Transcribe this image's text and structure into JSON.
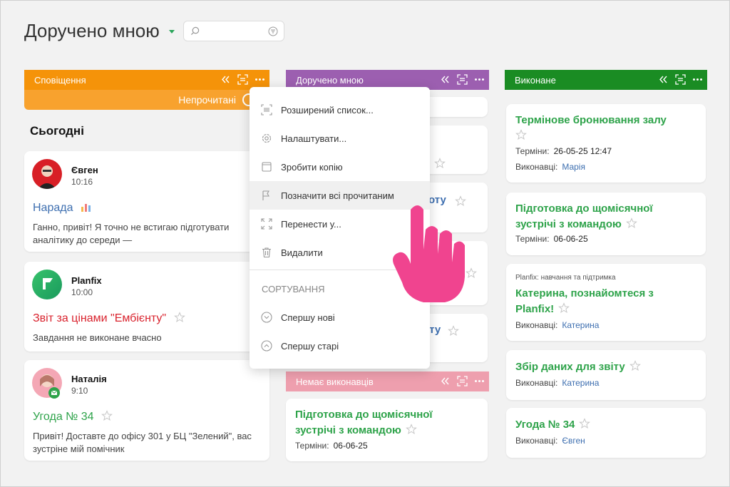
{
  "page": {
    "title": "Доручено мною"
  },
  "search": {
    "placeholder": ""
  },
  "columns": {
    "notifications": {
      "label": "Сповіщення",
      "unread_label": "Непрочитані"
    },
    "assigned": {
      "label": "Доручено мною"
    },
    "done": {
      "label": "Виконане"
    },
    "no_assignee": {
      "label": "Немає виконавців"
    }
  },
  "notifications": {
    "section": "Сьогодні",
    "items": [
      {
        "author": "Євген",
        "time": "10:16",
        "title": "Нарада",
        "title_color": "#3e6fb0",
        "body": "Ганно, привіт! Я точно не встигаю підготувати аналітику до середи —"
      },
      {
        "author": "Planfix",
        "time": "10:00",
        "title": "Звіт за цінами \"Ембієнту\"",
        "title_color": "#d9232e",
        "body": "Завдання не виконане вчасно"
      },
      {
        "author": "Наталія",
        "time": "9:10",
        "title": "Угода № 34",
        "title_color": "#2ea34a",
        "body": "Привіт! Доставте до офісу 301 у БЦ \"Зелений\", вас зустріне мій помічник"
      }
    ]
  },
  "assigned_visible": {
    "partial_1": "оту",
    "partial_2": "іту"
  },
  "no_assignee_card": {
    "title_line1": "Підготовка до щомісячної",
    "title_line2": "зустрічі з командою",
    "meta_label": "Терміни:",
    "meta_value": "06-06-25"
  },
  "done_cards": [
    {
      "title_line1": "Термінове бронювання залу",
      "meta_label": "Терміни:",
      "meta_value": "26-05-25 12:47",
      "meta2_label": "Виконавці:",
      "meta2_value": "Марія"
    },
    {
      "title_line1": "Підготовка до щомісячної",
      "title_line2": "зустрічі з командою",
      "meta_label": "Терміни:",
      "meta_value": "06-06-25"
    },
    {
      "project": "Planfix: навчання та підтримка",
      "title_line1": "Катерина, познайомтеся з",
      "title_line2": "Planfix!",
      "meta_label": "Виконавці:",
      "meta_value": "Катерина"
    },
    {
      "title_line1": "Збір даних для звіту",
      "meta_label": "Виконавці:",
      "meta_value": "Катерина"
    },
    {
      "title_line1": "Угода № 34",
      "meta_label": "Виконавці:",
      "meta_value": "Євген"
    }
  ],
  "menu": {
    "items": [
      {
        "label": "Розширений список...",
        "icon": "list-icon"
      },
      {
        "label": "Налаштувати...",
        "icon": "gear-icon"
      },
      {
        "label": "Зробити копію",
        "icon": "copy-icon"
      },
      {
        "label": "Позначити всі прочитаним",
        "icon": "flag-icon"
      },
      {
        "label": "Перенести у...",
        "icon": "move-icon"
      },
      {
        "label": "Видалити",
        "icon": "trash-icon"
      }
    ],
    "section_label": "СОРТУВАННЯ",
    "sort": [
      {
        "label": "Спершу нові",
        "icon": "chevron-down-circle-icon"
      },
      {
        "label": "Спершу старі",
        "icon": "chevron-up-circle-icon"
      }
    ]
  },
  "colors": {
    "orange": "#f59309",
    "purple": "#9c5fb0",
    "green": "#1a8c23",
    "pink": "#ee9fae",
    "task_green": "#2ea34a",
    "cursor": "#f0448f"
  }
}
